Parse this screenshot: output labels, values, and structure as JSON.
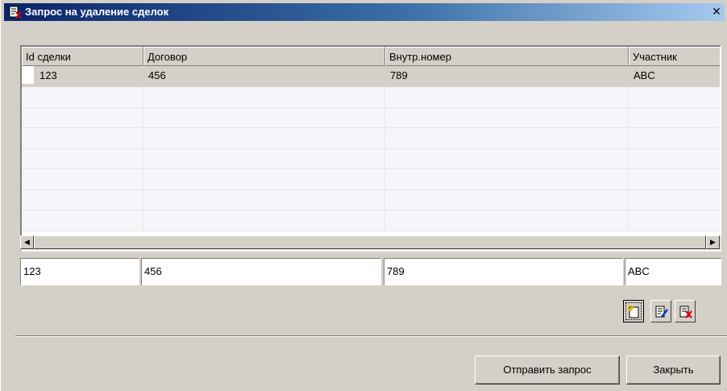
{
  "window": {
    "title": "Запрос на удаление сделок",
    "close_glyph": "✕",
    "title_icon": "document-delete-icon"
  },
  "grid": {
    "columns": [
      "Id сделки",
      "Договор",
      "Внутр.номер",
      "Участник"
    ],
    "rows": [
      [
        "123",
        "456",
        "789",
        "ABC"
      ]
    ],
    "empty_rows": 7
  },
  "scrollbar": {
    "left_arrow": "◀",
    "right_arrow": "▶"
  },
  "edit_fields": {
    "id": "123",
    "contract": "456",
    "internal_number": "789",
    "participant": "ABC"
  },
  "toolbar": {
    "icons": [
      "new-record-icon",
      "edit-record-icon",
      "delete-record-icon"
    ]
  },
  "buttons": {
    "send": "Отправить запрос",
    "close": "Закрыть"
  },
  "colors": {
    "title_gradient_start": "#0a246a",
    "title_gradient_end": "#a6caf0",
    "face": "#d4d0c8"
  }
}
